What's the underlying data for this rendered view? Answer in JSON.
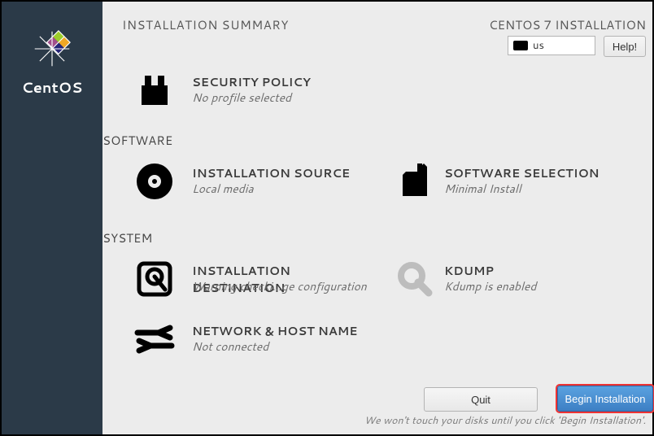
{
  "brand": "CentOS",
  "header": {
    "title": "INSTALLATION SUMMARY",
    "product": "CENTOS 7 INSTALLATION",
    "keyboard_layout": "us",
    "help_label": "Help!"
  },
  "spoke_security": {
    "title": "SECURITY POLICY",
    "status": "No profile selected"
  },
  "section_software": "SOFTWARE",
  "spoke_source": {
    "title": "INSTALLATION SOURCE",
    "status": "Local media"
  },
  "spoke_selection": {
    "title": "SOFTWARE SELECTION",
    "status": "Minimal Install"
  },
  "section_system": "SYSTEM",
  "spoke_destination": {
    "title": "INSTALLATION DESTINATION",
    "status": "Warning checki...ge configuration"
  },
  "spoke_kdump": {
    "title": "KDUMP",
    "status": "Kdump is enabled"
  },
  "spoke_network": {
    "title": "NETWORK & HOST NAME",
    "status": "Not connected"
  },
  "buttons": {
    "quit": "Quit",
    "begin": "Begin Installation"
  },
  "hint": "We won't touch your disks until you click 'Begin Installation'."
}
